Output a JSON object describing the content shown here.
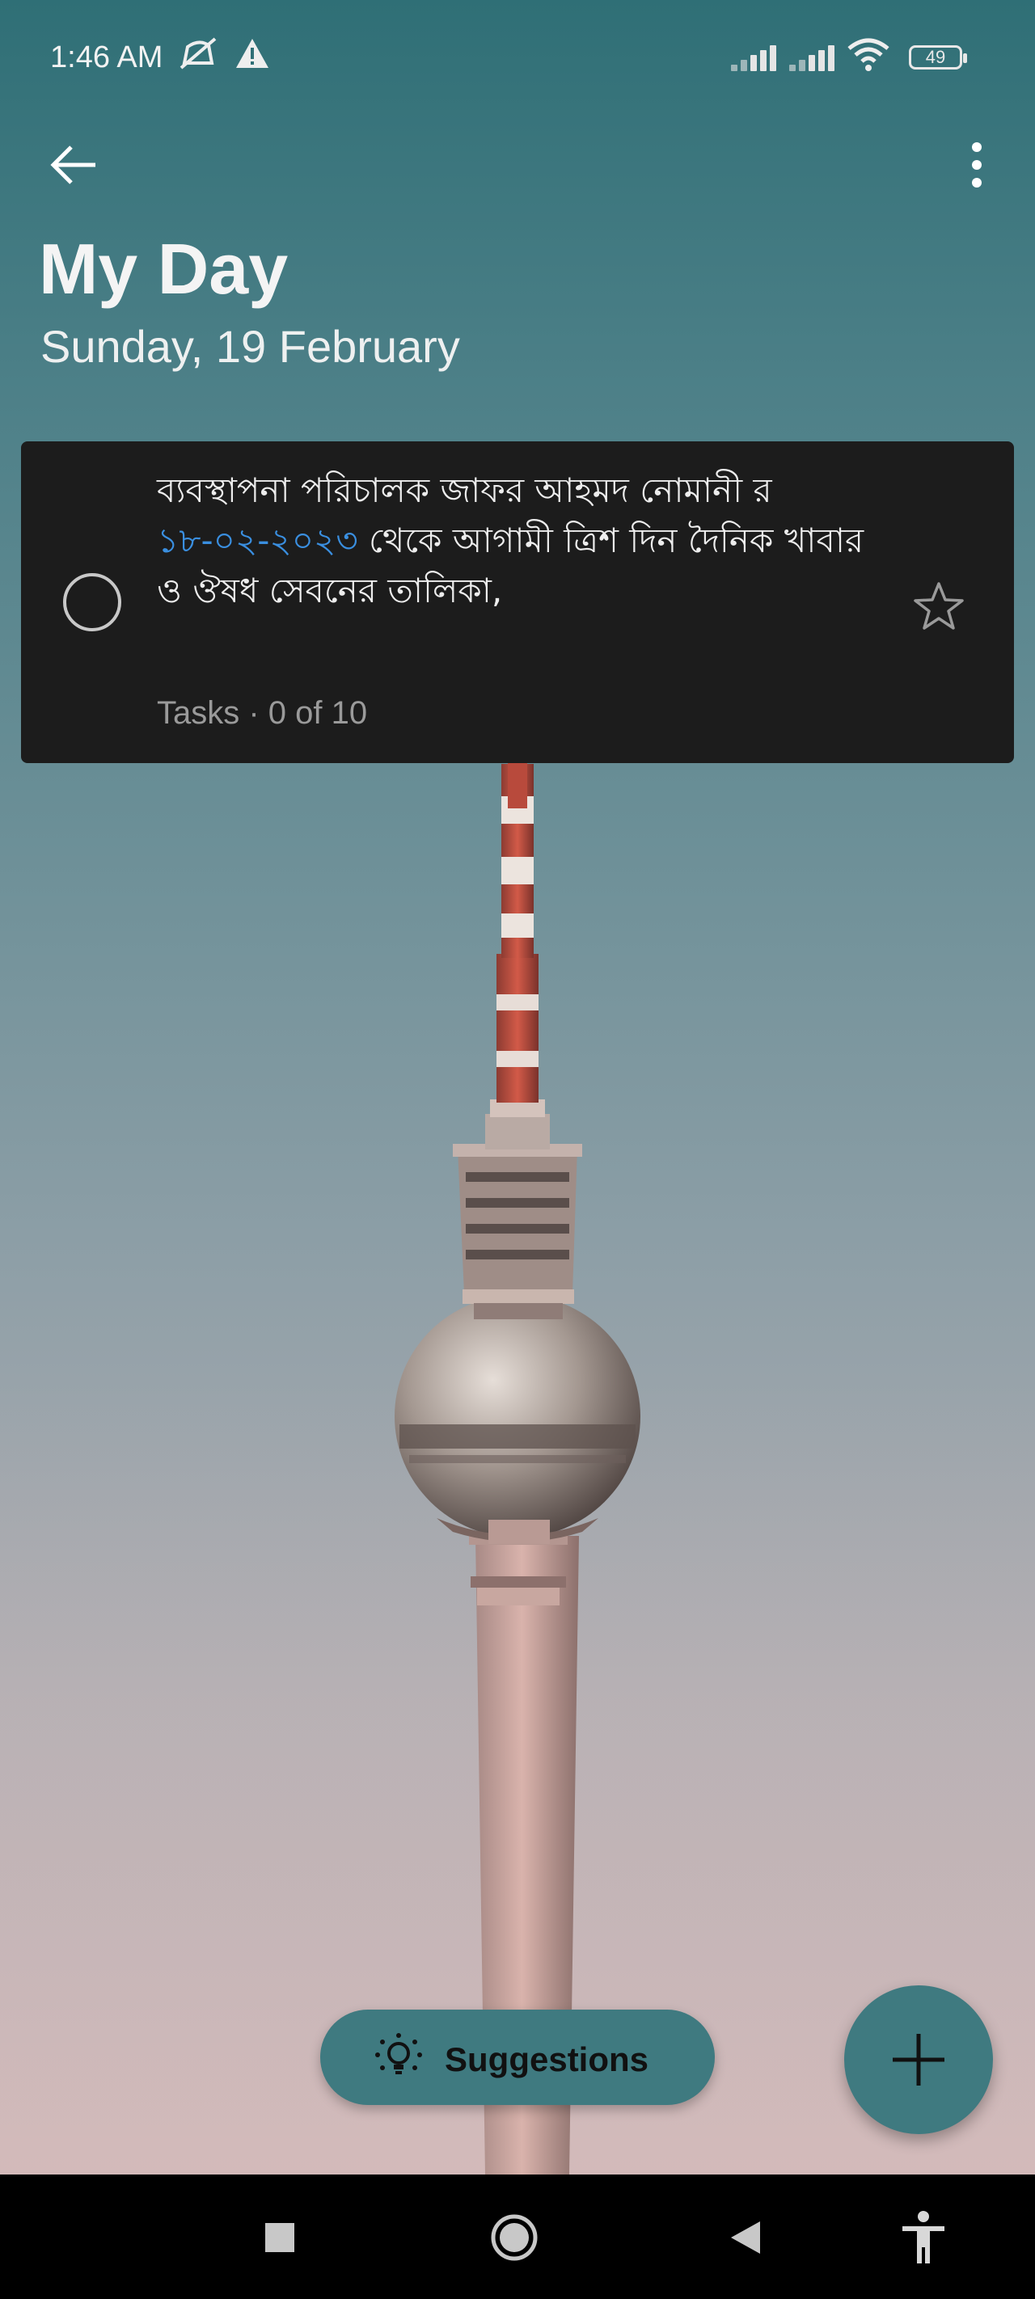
{
  "status_bar": {
    "time": "1:46 AM",
    "battery": "49",
    "icons": [
      "mute-icon",
      "alert-icon",
      "signal-icon",
      "signal-icon",
      "wifi-icon",
      "battery-icon"
    ]
  },
  "app_bar": {
    "title": "My Day",
    "subtitle": "Sunday, 19 February"
  },
  "task": {
    "text_part1": "ব্যবস্থাপনা পরিচালক জাফর আহমদ নোমানী র ",
    "date": "১৮-০২-২০২৩",
    "text_part2": " থেকে আগামী ত্রিশ দিন দৈনিক খাবার ও ঔষধ সেবনের তালিকা,",
    "meta": "Tasks · 0 of 10",
    "completed": false,
    "important": false
  },
  "actions": {
    "suggestions_label": "Suggestions"
  },
  "colors": {
    "accent": "#3f7a80",
    "card": "#1c1c1c",
    "date_link": "#3a8fe0"
  }
}
